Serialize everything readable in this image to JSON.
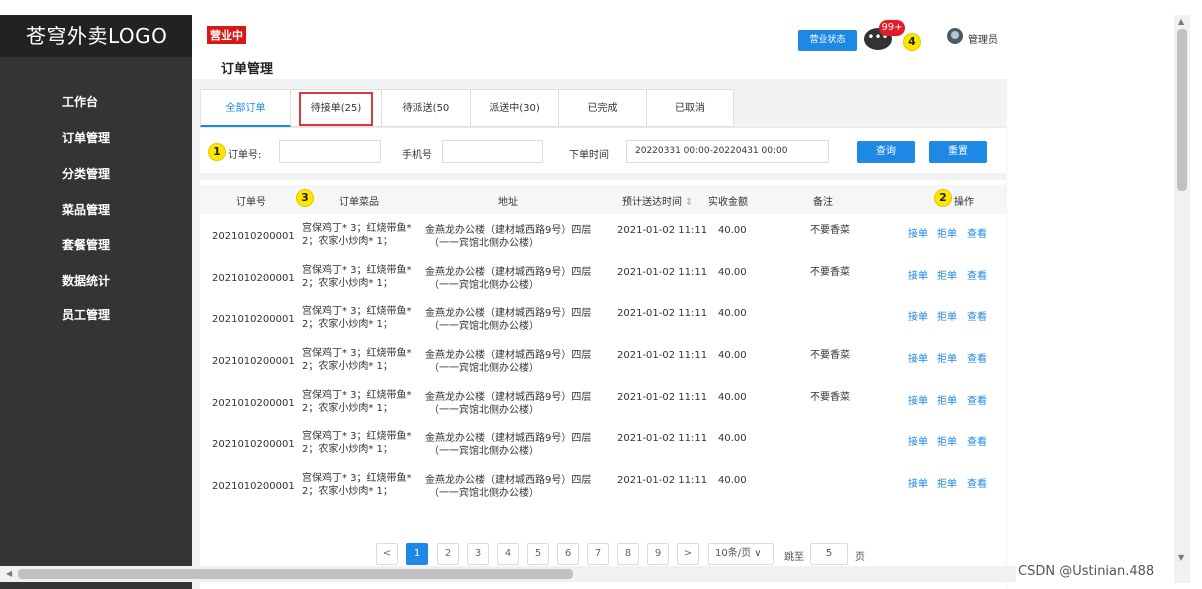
{
  "brand": "苍穹外卖LOGO",
  "sidebar": {
    "items": [
      {
        "label": "工作台"
      },
      {
        "label": "订单管理"
      },
      {
        "label": "分类管理"
      },
      {
        "label": "菜品管理"
      },
      {
        "label": "套餐管理"
      },
      {
        "label": "数据统计"
      },
      {
        "label": "员工管理"
      }
    ]
  },
  "header": {
    "status_badge": "营业中",
    "page_title": "订单管理",
    "status_button": "营业状态",
    "message_count": "99+",
    "admin_name": "管理员",
    "message_icon_text": "•••"
  },
  "annotations": {
    "one": "1",
    "two": "2",
    "three": "3",
    "four": "4"
  },
  "tabs": [
    {
      "label": "全部订单"
    },
    {
      "label": "待接单(25)"
    },
    {
      "label": "待派送(50"
    },
    {
      "label": "派送中(30)"
    },
    {
      "label": "已完成"
    },
    {
      "label": "已取消"
    }
  ],
  "filters": {
    "order_no_label": "订单号:",
    "order_no_value": "",
    "phone_label": "手机号",
    "phone_value": "",
    "time_label": "下单时间",
    "time_value": "20220331 00:00-20220431 00:00",
    "query_button": "查询",
    "reset_button": "重置"
  },
  "table": {
    "columns": [
      "订单号",
      "订单菜品",
      "地址",
      "预计送达时间",
      "实收金额",
      "备注",
      "操作"
    ],
    "sort_icon": "⇕",
    "rows": [
      {
        "order_no": "2021010200001",
        "dishes_1": "宫保鸡丁* 3；红烧带鱼*",
        "dishes_2": "2；农家小炒肉* 1；",
        "address_1": "金燕龙办公楼（建材城西路9号）四层",
        "address_2": "（一一宾馆北侧办公楼）",
        "time": "2021-01-02 11:11",
        "amount": "40.00",
        "note": "不要香菜"
      },
      {
        "order_no": "2021010200001",
        "dishes_1": "宫保鸡丁* 3；红烧带鱼*",
        "dishes_2": "2；农家小炒肉* 1；",
        "address_1": "金燕龙办公楼（建材城西路9号）四层",
        "address_2": "（一一宾馆北侧办公楼）",
        "time": "2021-01-02 11:11",
        "amount": "40.00",
        "note": "不要香菜"
      },
      {
        "order_no": "2021010200001",
        "dishes_1": "宫保鸡丁* 3；红烧带鱼*",
        "dishes_2": "2；农家小炒肉* 1；",
        "address_1": "金燕龙办公楼（建材城西路9号）四层",
        "address_2": "（一一宾馆北侧办公楼）",
        "time": "2021-01-02 11:11",
        "amount": "40.00",
        "note": ""
      },
      {
        "order_no": "2021010200001",
        "dishes_1": "宫保鸡丁* 3；红烧带鱼*",
        "dishes_2": "2；农家小炒肉* 1；",
        "address_1": "金燕龙办公楼（建材城西路9号）四层",
        "address_2": "（一一宾馆北侧办公楼）",
        "time": "2021-01-02 11:11",
        "amount": "40.00",
        "note": "不要香菜"
      },
      {
        "order_no": "2021010200001",
        "dishes_1": "宫保鸡丁* 3；红烧带鱼*",
        "dishes_2": "2；农家小炒肉* 1；",
        "address_1": "金燕龙办公楼（建材城西路9号）四层",
        "address_2": "（一一宾馆北侧办公楼）",
        "time": "2021-01-02 11:11",
        "amount": "40.00",
        "note": "不要香菜"
      },
      {
        "order_no": "2021010200001",
        "dishes_1": "宫保鸡丁* 3；红烧带鱼*",
        "dishes_2": "2；农家小炒肉* 1；",
        "address_1": "金燕龙办公楼（建材城西路9号）四层",
        "address_2": "（一一宾馆北侧办公楼）",
        "time": "2021-01-02 11:11",
        "amount": "40.00",
        "note": ""
      },
      {
        "order_no": "2021010200001",
        "dishes_1": "宫保鸡丁* 3；红烧带鱼*",
        "dishes_2": "2；农家小炒肉* 1；",
        "address_1": "金燕龙办公楼（建材城西路9号）四层",
        "address_2": "（一一宾馆北侧办公楼）",
        "time": "2021-01-02 11:11",
        "amount": "40.00",
        "note": ""
      }
    ],
    "actions": {
      "accept": "接单",
      "reject": "拒单",
      "view": "查看"
    }
  },
  "pagination": {
    "prev": "<",
    "next": ">",
    "pages": [
      "1",
      "2",
      "3",
      "4",
      "5",
      "6",
      "7",
      "8",
      "9"
    ],
    "current_page": "1",
    "page_size": "10条/页 ∨",
    "jump_label": "跳至",
    "jump_value": "5",
    "page_suffix": "页"
  },
  "watermark": "CSDN @Ustinian.488",
  "colors": {
    "primary": "#1e88e5",
    "sidebar": "#343434",
    "danger": "#d81818",
    "highlight": "#ffe600"
  }
}
